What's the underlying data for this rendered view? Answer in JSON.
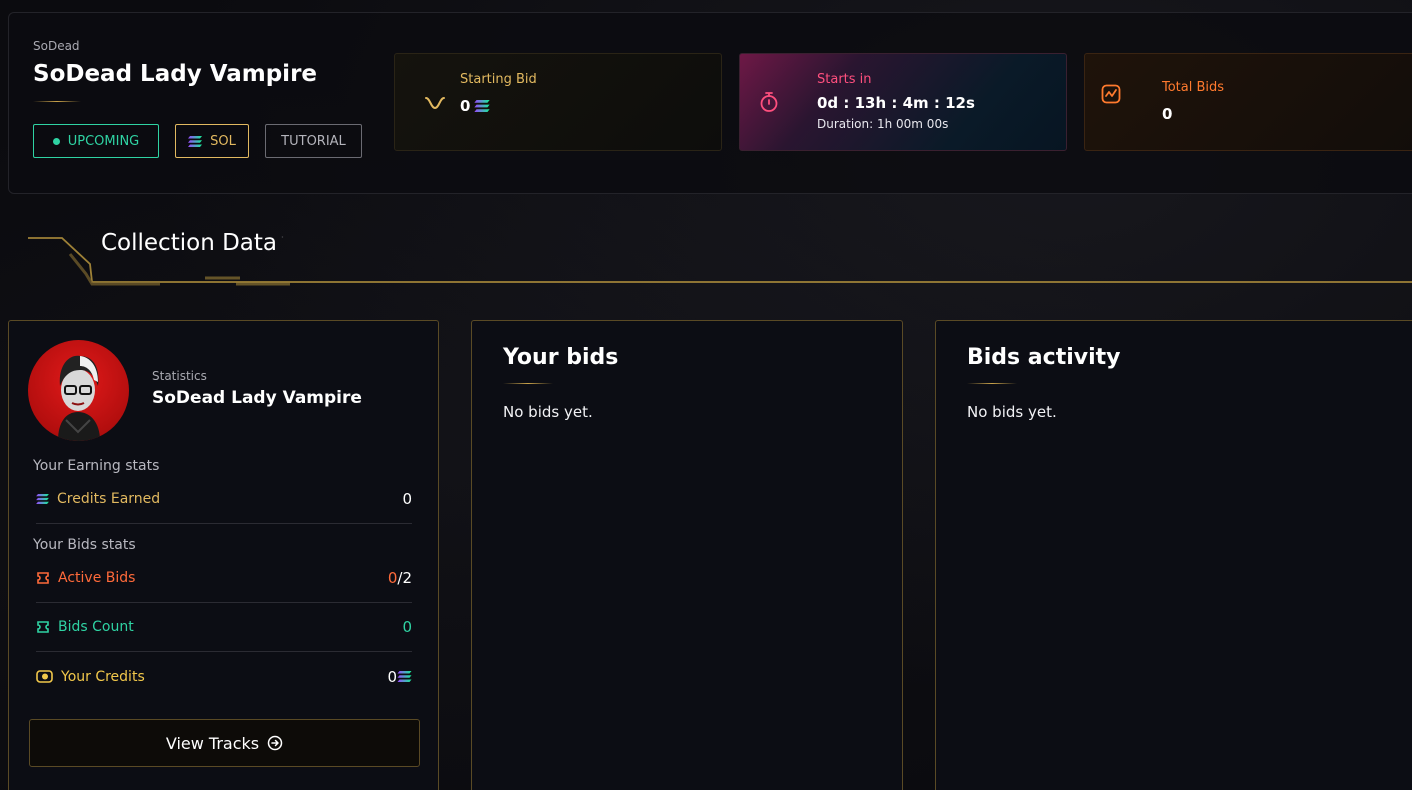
{
  "header": {
    "collection_name": "SoDead",
    "nft_title": "SoDead Lady Vampire",
    "tags": {
      "status": "UPCOMING",
      "currency": "SOL",
      "tutorial": "TUTORIAL"
    }
  },
  "cards": {
    "starting_bid": {
      "label": "Starting Bid",
      "value": "0",
      "icon": "wave-icon",
      "accent": "#e2b960"
    },
    "starts_in": {
      "label": "Starts in",
      "value": "0d : 13h : 4m : 12s",
      "duration": "Duration: 1h 00m 00s",
      "icon": "stopwatch-icon",
      "accent": "#ff4f7e"
    },
    "total_bids": {
      "label": "Total Bids",
      "value": "0",
      "icon": "chart-icon",
      "accent": "#ff7a2e"
    }
  },
  "section": {
    "title": "Collection Data"
  },
  "stats_panel": {
    "label": "Statistics",
    "name": "SoDead Lady Vampire",
    "earning_group": "Your Earning stats",
    "credits_earned": {
      "label": "Credits Earned",
      "value": "0",
      "color": "#e2b960"
    },
    "bids_group": "Your Bids stats",
    "active_bids": {
      "label": "Active Bids",
      "value_active": "0",
      "value_sep": "/",
      "value_max": "2",
      "color": "#ff6a3a"
    },
    "bids_count": {
      "label": "Bids Count",
      "value": "0",
      "color": "#2fd3a3"
    },
    "your_credits": {
      "label": "Your Credits",
      "value": "0",
      "color": "#f2c84b"
    },
    "view_tracks": "View Tracks"
  },
  "your_bids": {
    "title": "Your bids",
    "empty": "No bids yet."
  },
  "bids_activity": {
    "title": "Bids activity",
    "empty": "No bids yet."
  }
}
